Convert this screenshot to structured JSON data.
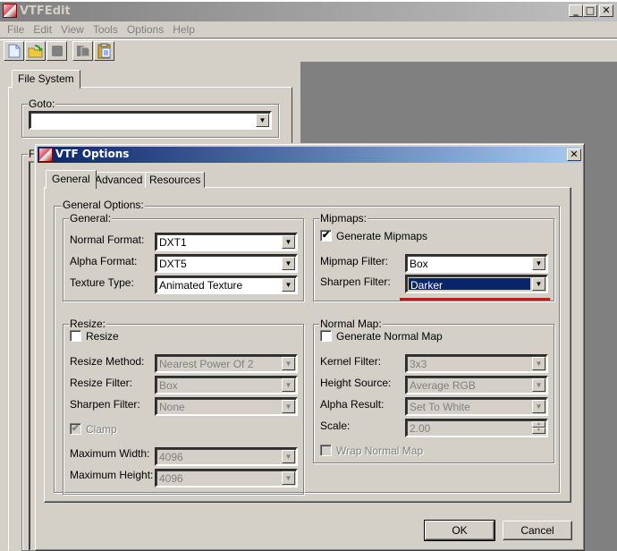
{
  "main_window": {
    "title": "VTFEdit",
    "caption_buttons": {
      "minimize": "_",
      "maximize": "□",
      "close": "✕"
    },
    "menu": [
      "File",
      "Edit",
      "View",
      "Tools",
      "Options",
      "Help"
    ],
    "toolbar": [
      {
        "name": "new-icon",
        "enabled": true
      },
      {
        "name": "open-icon",
        "enabled": true
      },
      {
        "name": "save-icon",
        "enabled": false
      },
      {
        "name": "copy-icon",
        "enabled": false
      },
      {
        "name": "paste-icon",
        "enabled": true
      }
    ],
    "left_panel": {
      "tab": "File System",
      "goto_label": "Goto:",
      "goto_value": "",
      "second_group_label": "F"
    }
  },
  "dialog": {
    "title": "VTF Options",
    "close": "✕",
    "tabs": [
      "General",
      "Advanced",
      "Resources"
    ],
    "active_tab": "General",
    "general_options_label": "General Options:",
    "general": {
      "label": "General:",
      "normal_format": {
        "label": "Normal Format:",
        "value": "DXT1"
      },
      "alpha_format": {
        "label": "Alpha Format:",
        "value": "DXT5"
      },
      "texture_type": {
        "label": "Texture Type:",
        "value": "Animated Texture"
      }
    },
    "mipmaps": {
      "label": "Mipmaps:",
      "generate": {
        "label": "Generate Mipmaps",
        "checked": true
      },
      "mipmap_filter": {
        "label": "Mipmap Filter:",
        "value": "Box"
      },
      "sharpen_filter": {
        "label": "Sharpen Filter:",
        "value": "Darker"
      }
    },
    "resize": {
      "label": "Resize:",
      "resize": {
        "label": "Resize",
        "checked": false
      },
      "method": {
        "label": "Resize Method:",
        "value": "Nearest Power Of 2"
      },
      "filter": {
        "label": "Resize Filter:",
        "value": "Box"
      },
      "sharpen": {
        "label": "Sharpen Filter:",
        "value": "None"
      },
      "clamp": {
        "label": "Clamp",
        "checked": true
      },
      "max_width": {
        "label": "Maximum Width:",
        "value": "4096"
      },
      "max_height": {
        "label": "Maximum Height:",
        "value": "4096"
      }
    },
    "normal_map": {
      "label": "Normal Map:",
      "generate": {
        "label": "Generate Normal Map",
        "checked": false
      },
      "kernel": {
        "label": "Kernel Filter:",
        "value": "3x3"
      },
      "height_source": {
        "label": "Height Source:",
        "value": "Average RGB"
      },
      "alpha_result": {
        "label": "Alpha Result:",
        "value": "Set To White"
      },
      "scale": {
        "label": "Scale:",
        "value": "2.00"
      },
      "wrap": {
        "label": "Wrap Normal Map",
        "checked": false
      }
    },
    "ok_label": "OK",
    "cancel_label": "Cancel",
    "highlight_color": "#ff0000"
  }
}
